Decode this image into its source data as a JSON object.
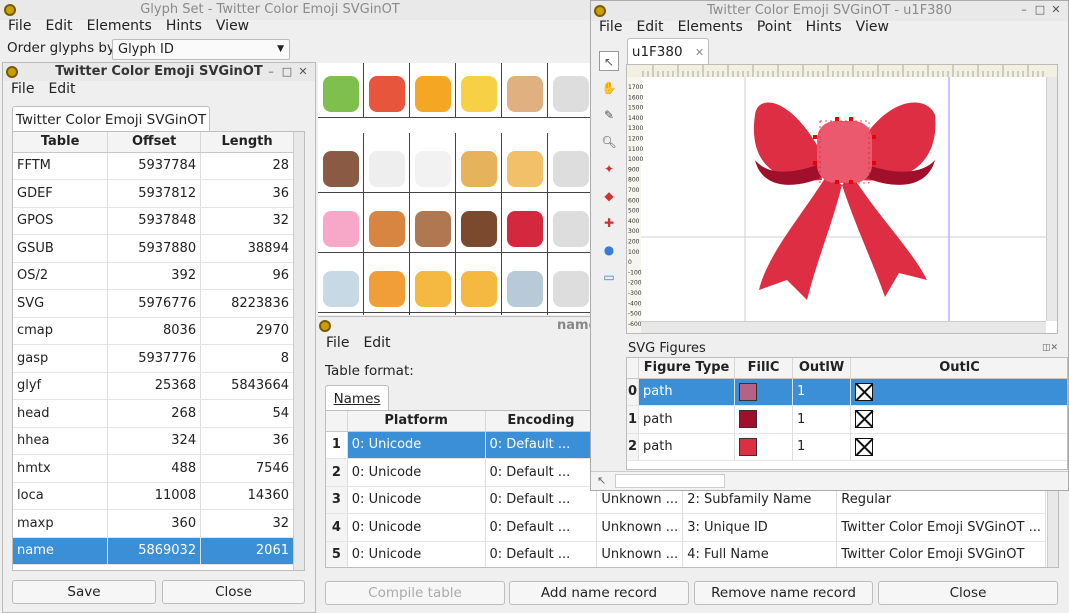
{
  "glyphset": {
    "title": "Glyph Set - Twitter Color Emoji SVGinOT",
    "menu": [
      "File",
      "Edit",
      "Elements",
      "Hints",
      "View"
    ],
    "order_label": "Order glyphs by:",
    "order_value": "Glyph ID"
  },
  "tables_win": {
    "title": "Twitter Color Emoji SVGinOT",
    "menu": [
      "File",
      "Edit"
    ],
    "tab": "Twitter Color Emoji SVGinOT",
    "headers": [
      "Table",
      "Offset",
      "Length"
    ],
    "rows": [
      [
        "FFTM",
        "5937784",
        "28"
      ],
      [
        "GDEF",
        "5937812",
        "36"
      ],
      [
        "GPOS",
        "5937848",
        "32"
      ],
      [
        "GSUB",
        "5937880",
        "38894"
      ],
      [
        "OS/2",
        "392",
        "96"
      ],
      [
        "SVG",
        "5976776",
        "8223836"
      ],
      [
        "cmap",
        "8036",
        "2970"
      ],
      [
        "gasp",
        "5937776",
        "8"
      ],
      [
        "glyf",
        "25368",
        "5843664"
      ],
      [
        "head",
        "268",
        "54"
      ],
      [
        "hhea",
        "324",
        "36"
      ],
      [
        "hmtx",
        "488",
        "7546"
      ],
      [
        "loca",
        "11008",
        "14360"
      ],
      [
        "maxp",
        "360",
        "32"
      ],
      [
        "name",
        "5869032",
        "2061"
      ]
    ],
    "selected_row": 14,
    "save": "Save",
    "close": "Close"
  },
  "name_win": {
    "title_fragment": "name",
    "menu": [
      "File",
      "Edit"
    ],
    "table_format_label": "Table format:",
    "tab": "Names",
    "headers": [
      "Platform",
      "Encoding"
    ],
    "rows": [
      {
        "n": "1",
        "platform": "0: Unicode",
        "encoding": "0: Default ...",
        "lang": "",
        "nameid": "",
        "value": ""
      },
      {
        "n": "2",
        "platform": "0: Unicode",
        "encoding": "0: Default ...",
        "lang": "",
        "nameid": "",
        "value": ""
      },
      {
        "n": "3",
        "platform": "0: Unicode",
        "encoding": "0: Default ...",
        "lang": "Unknown ...",
        "nameid": "2: Subfamily Name",
        "value": "Regular"
      },
      {
        "n": "4",
        "platform": "0: Unicode",
        "encoding": "0: Default ...",
        "lang": "Unknown ...",
        "nameid": "3: Unique ID",
        "value": "Twitter Color Emoji SVGinOT ..."
      },
      {
        "n": "5",
        "platform": "0: Unicode",
        "encoding": "0: Default ...",
        "lang": "Unknown ...",
        "nameid": "4: Full Name",
        "value": "Twitter Color Emoji SVGinOT"
      }
    ],
    "buttons": [
      "Compile table",
      "Add name record",
      "Remove name record",
      "Close"
    ]
  },
  "glyph_win": {
    "title": "Twitter Color Emoji SVGinOT - u1F380",
    "menu": [
      "File",
      "Edit",
      "Elements",
      "Point",
      "Hints",
      "View"
    ],
    "tab": "u1F380",
    "ruler_labels": [
      "1700",
      "1600",
      "1500",
      "1400",
      "1300",
      "1200",
      "1100",
      "1000",
      "900",
      "800",
      "700",
      "600",
      "500",
      "400",
      "300",
      "200",
      "100",
      "0",
      "-100",
      "-200",
      "-300",
      "-400",
      "-500",
      "-600"
    ],
    "svg_panel_title": "SVG Figures",
    "fig_headers": [
      "Figure Type",
      "FillC",
      "OutlW",
      "OutlC"
    ],
    "figures": [
      {
        "n": "0",
        "type": "path",
        "fill": "#b46386",
        "width": "1"
      },
      {
        "n": "1",
        "type": "path",
        "fill": "#a0102a",
        "width": "1"
      },
      {
        "n": "2",
        "type": "path",
        "fill": "#dd2e44",
        "width": "1"
      }
    ],
    "colors": {
      "bow": "#dd2e44",
      "bow_dark": "#a0102a",
      "knot": "#ea596e"
    }
  }
}
